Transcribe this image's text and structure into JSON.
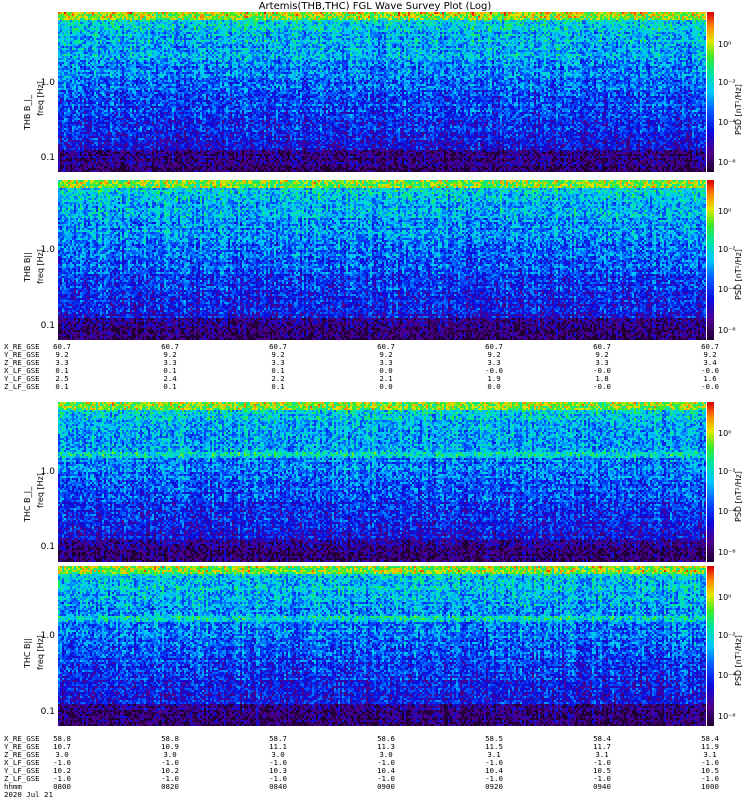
{
  "title": "Artemis(THB,THC) FGL Wave Survey Plot (Log)",
  "colors": {
    "background": "#ffffff",
    "text": "#000000"
  },
  "panels": [
    {
      "id": "thb-bl",
      "ylabel": "THB B_|_",
      "yunit": "freq [Hz]",
      "cb_label": "PSD [nT²/Hz]",
      "yticks": [
        "1.0",
        "0.1"
      ],
      "cbticks": [
        "10⁰",
        "10⁻²",
        "10⁻⁴",
        "10⁻⁶"
      ]
    },
    {
      "id": "thb-bpar",
      "ylabel": "THB B||",
      "yunit": "freq [Hz]",
      "cb_label": "PSD [nT²/Hz]",
      "yticks": [
        "1.0",
        "0.1"
      ],
      "cbticks": [
        "10⁰",
        "10⁻²",
        "10⁻⁴",
        "10⁻⁶"
      ]
    },
    {
      "id": "thc-bl",
      "ylabel": "THC B_|_",
      "yunit": "freq [Hz]",
      "cb_label": "PSD [nT²/Hz]",
      "yticks": [
        "1.0",
        "0.1"
      ],
      "cbticks": [
        "10⁰",
        "10⁻²",
        "10⁻⁴",
        "10⁻⁶"
      ]
    },
    {
      "id": "thc-bpar",
      "ylabel": "THC B||",
      "yunit": "freq [Hz]",
      "cb_label": "PSD [nT²/Hz]",
      "yticks": [
        "1.0",
        "0.1"
      ],
      "cbticks": [
        "10⁰",
        "10⁻²",
        "10⁻⁴",
        "10⁻⁶"
      ]
    }
  ],
  "ephem_thb": {
    "labels": [
      "X_RE_GSE",
      "Y_RE_GSE",
      "Z_RE_GSE",
      "X_LF_GSE",
      "Y_LF_GSE",
      "Z_LF_GSE"
    ],
    "values": [
      [
        "60.7",
        "60.7",
        "60.7",
        "60.7",
        "60.7",
        "60.7",
        "60.7"
      ],
      [
        "9.2",
        "9.2",
        "9.2",
        "9.2",
        "9.2",
        "9.2",
        "9.2"
      ],
      [
        "3.3",
        "3.3",
        "3.3",
        "3.3",
        "3.3",
        "3.3",
        "3.4"
      ],
      [
        "0.1",
        "0.1",
        "0.1",
        "0.0",
        "-0.0",
        "-0.0",
        "-0.0"
      ],
      [
        "2.5",
        "2.4",
        "2.2",
        "2.1",
        "1.9",
        "1.8",
        "1.6"
      ],
      [
        "0.1",
        "0.1",
        "0.1",
        "0.0",
        "0.0",
        "-0.0",
        "-0.0"
      ]
    ]
  },
  "ephem_thc": {
    "labels": [
      "X_RE_GSE",
      "Y_RE_GSE",
      "Z_RE_GSE",
      "X_LF_GSE",
      "Y_LF_GSE",
      "Z_LF_GSE",
      "hhmm",
      "2020 Jul 21"
    ],
    "values": [
      [
        "58.8",
        "58.8",
        "58.7",
        "58.6",
        "58.5",
        "58.4",
        "58.4"
      ],
      [
        "10.7",
        "10.9",
        "11.1",
        "11.3",
        "11.5",
        "11.7",
        "11.9"
      ],
      [
        "3.0",
        "3.0",
        "3.0",
        "3.0",
        "3.1",
        "3.1",
        "3.1"
      ],
      [
        "-1.0",
        "-1.0",
        "-1.0",
        "-1.0",
        "-1.0",
        "-1.0",
        "-1.0"
      ],
      [
        "10.2",
        "10.2",
        "10.3",
        "10.4",
        "10.4",
        "10.5",
        "10.5"
      ],
      [
        "-1.0",
        "-1.0",
        "-1.0",
        "-1.0",
        "-1.0",
        "-1.0",
        "-1.0"
      ],
      [
        "0800",
        "0820",
        "0840",
        "0900",
        "0920",
        "0940",
        "1000"
      ]
    ]
  },
  "chart_data": [
    {
      "type": "heatmap",
      "title": "Artemis(THB,THC) FGL Wave Survey Plot (Log)",
      "panel": "THB B_|_",
      "ylabel": "freq [Hz]",
      "yscale": "log",
      "ylim": [
        0.05,
        8
      ],
      "x_range": [
        "0800",
        "1000"
      ],
      "colorbar": {
        "label": "PSD [nT²/Hz]",
        "scale": "log",
        "range": [
          1e-07,
          10.0
        ]
      }
    },
    {
      "type": "heatmap",
      "panel": "THB B||",
      "ylabel": "freq [Hz]",
      "yscale": "log",
      "ylim": [
        0.05,
        8
      ],
      "x_range": [
        "0800",
        "1000"
      ],
      "colorbar": {
        "label": "PSD [nT²/Hz]",
        "scale": "log",
        "range": [
          1e-07,
          10.0
        ]
      }
    },
    {
      "type": "heatmap",
      "panel": "THC B_|_",
      "ylabel": "freq [Hz]",
      "yscale": "log",
      "ylim": [
        0.05,
        8
      ],
      "x_range": [
        "0800",
        "1000"
      ],
      "colorbar": {
        "label": "PSD [nT²/Hz]",
        "scale": "log",
        "range": [
          1e-07,
          10.0
        ]
      }
    },
    {
      "type": "heatmap",
      "panel": "THC B||",
      "ylabel": "freq [Hz]",
      "yscale": "log",
      "ylim": [
        0.05,
        8
      ],
      "x_range": [
        "0800",
        "1000"
      ],
      "colorbar": {
        "label": "PSD [nT²/Hz]",
        "scale": "log",
        "range": [
          1e-07,
          10.0
        ]
      }
    }
  ]
}
